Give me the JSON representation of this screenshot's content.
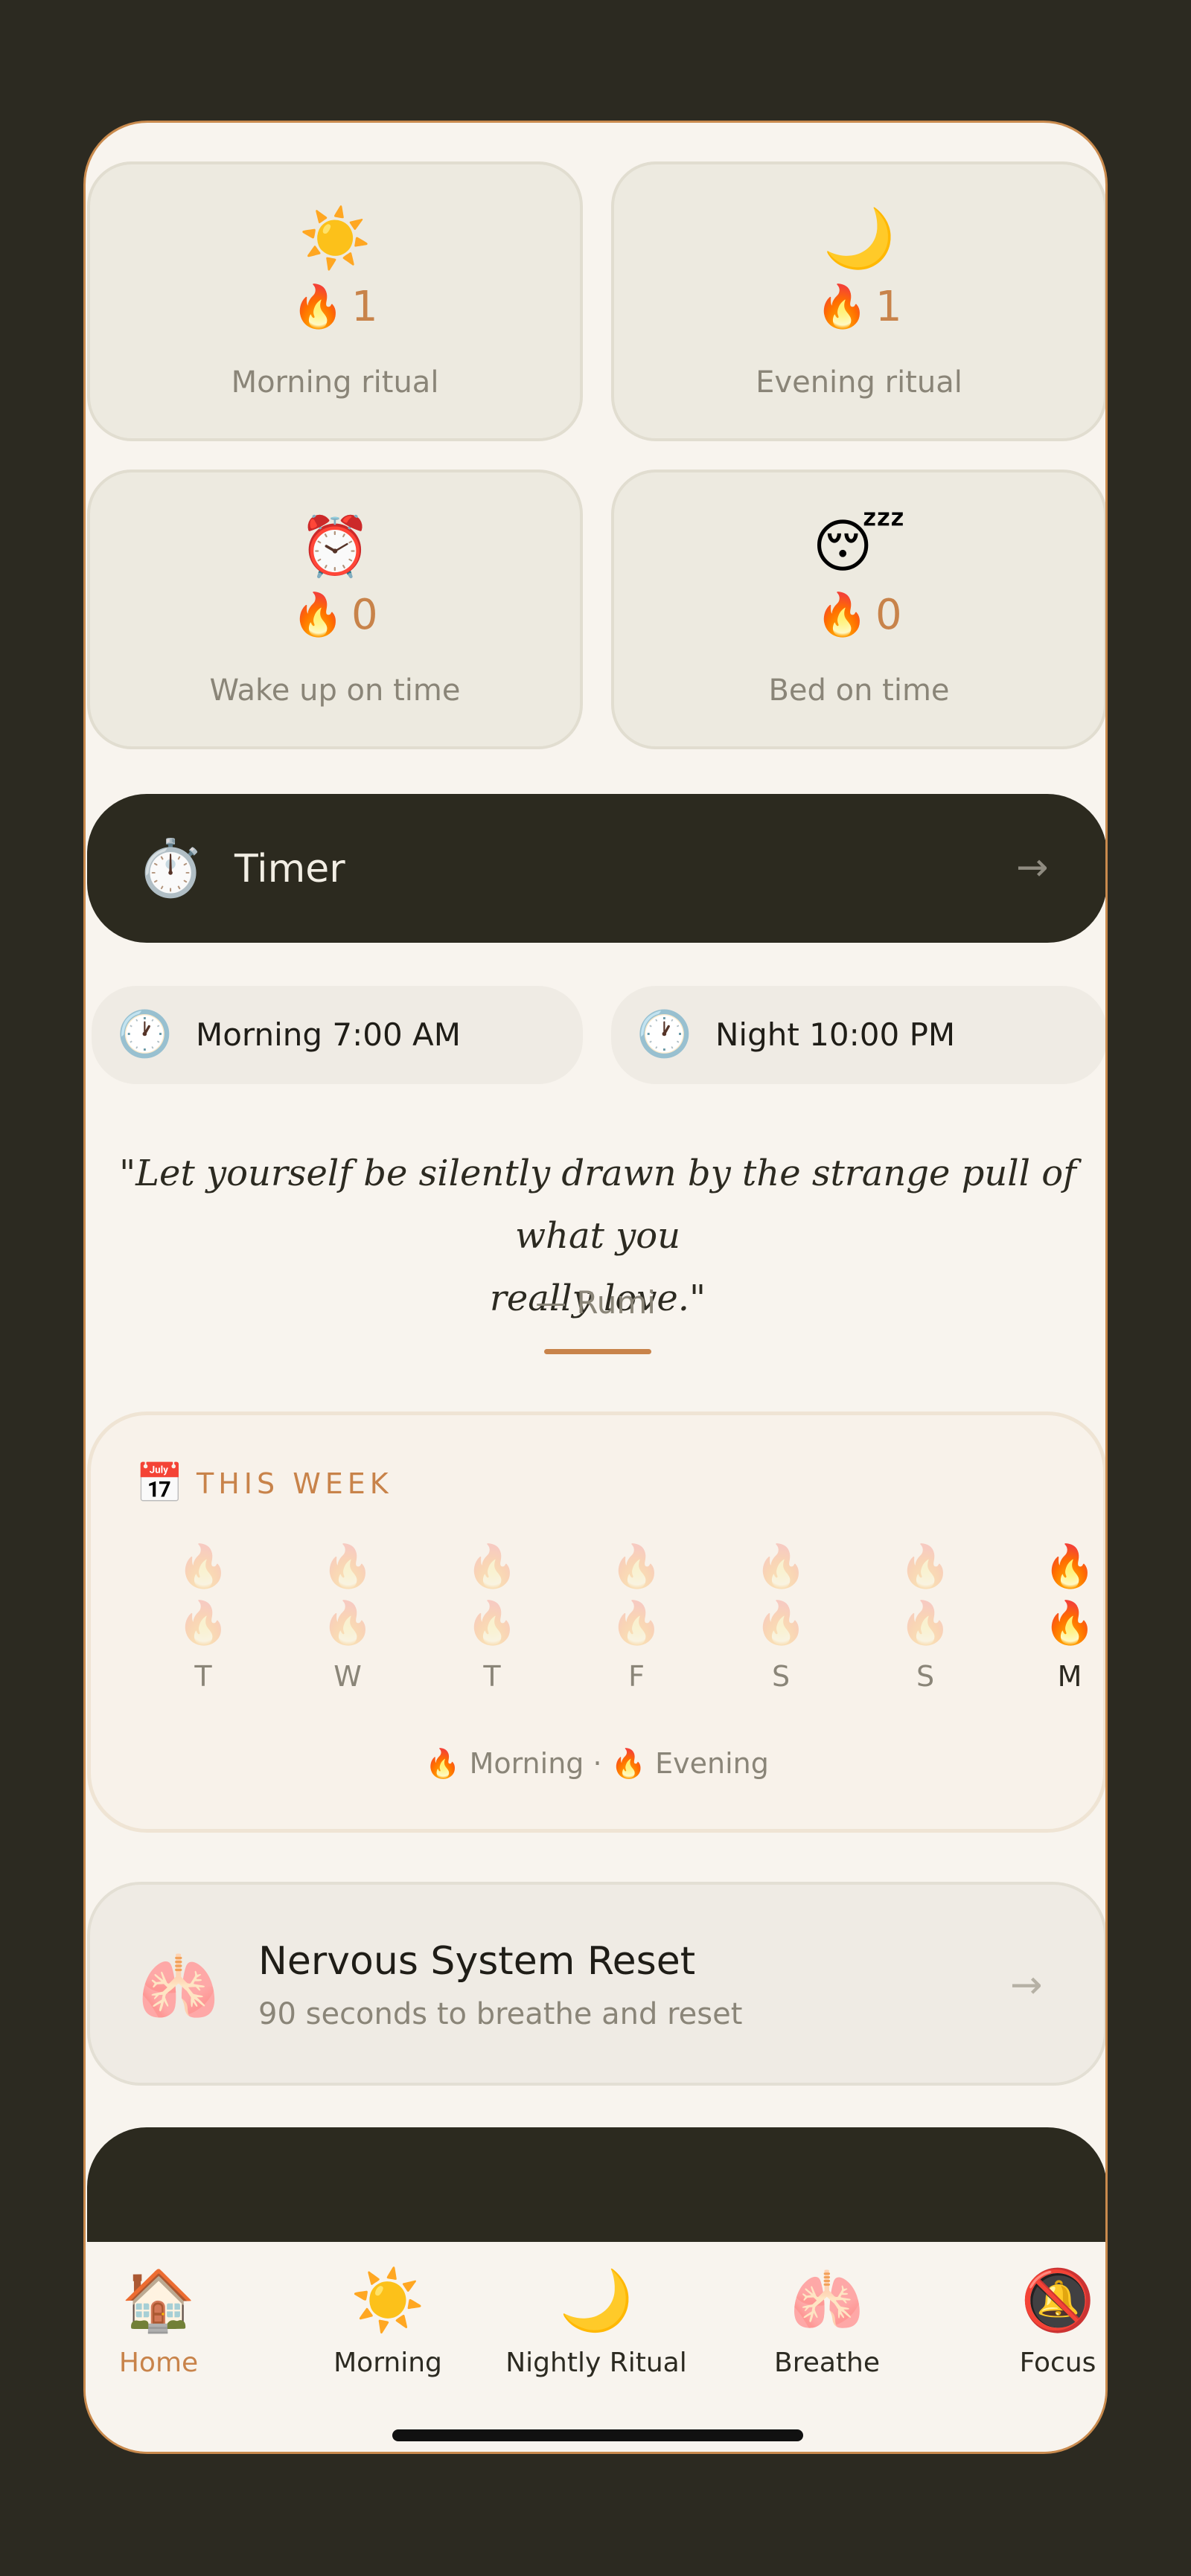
{
  "stats": [
    {
      "icon": "☀️",
      "count": "1",
      "label": "Morning ritual"
    },
    {
      "icon": "🌙",
      "count": "1",
      "label": "Evening ritual"
    },
    {
      "icon": "⏰",
      "count": "0",
      "label": "Wake up on time"
    },
    {
      "icon": "😴",
      "count": "0",
      "label": "Bed on time"
    }
  ],
  "fire_icon": "🔥",
  "timer": {
    "icon": "⏱️",
    "label": "Timer",
    "arrow": "→"
  },
  "times": {
    "morning": {
      "icon": "🕐",
      "text": "Morning 7:00 AM"
    },
    "night": {
      "icon": "🕐",
      "text": "Night 10:00 PM"
    }
  },
  "quote": {
    "line1": "\"Let yourself be silently drawn by the strange pull of what you",
    "line2": "really love.\"",
    "author": "— Rumi"
  },
  "week": {
    "icon": "📅",
    "title": "THIS WEEK",
    "days": [
      {
        "letter": "T",
        "morning": false,
        "evening": false
      },
      {
        "letter": "W",
        "morning": false,
        "evening": false
      },
      {
        "letter": "T",
        "morning": false,
        "evening": false
      },
      {
        "letter": "F",
        "morning": false,
        "evening": false
      },
      {
        "letter": "S",
        "morning": false,
        "evening": false
      },
      {
        "letter": "S",
        "morning": false,
        "evening": false
      },
      {
        "letter": "M",
        "morning": true,
        "evening": true
      }
    ],
    "legend_morning": "Morning",
    "legend_sep": "·",
    "legend_evening": "Evening"
  },
  "reset": {
    "icon": "🫁",
    "title": "Nervous System Reset",
    "subtitle": "90 seconds to breathe and reset",
    "arrow": "→"
  },
  "tabs": [
    {
      "icon": "🏠",
      "label": "Home",
      "active": true
    },
    {
      "icon": "☀️",
      "label": "Morning",
      "active": false
    },
    {
      "icon": "🌙",
      "label": "Nightly Ritual",
      "active": false
    },
    {
      "icon": "🫁",
      "label": "Breathe",
      "active": false
    },
    {
      "icon": "🔕",
      "label": "Focus",
      "active": false
    }
  ],
  "colors": {
    "accent": "#c8834a",
    "background": "#2c2a21",
    "surface": "#f8f4ee",
    "dark_card": "#2c2a1f"
  }
}
